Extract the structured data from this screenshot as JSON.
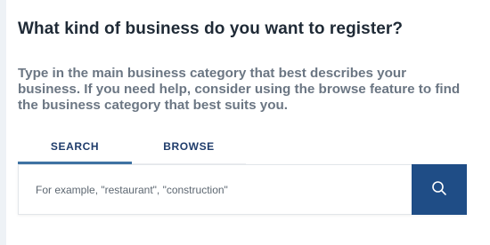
{
  "heading": "What kind of business do you want to register?",
  "description": "Type in the main business category that best describes your business. If you need help, consider using the browse feature to find the business category that best suits you.",
  "tabs": [
    {
      "label": "SEARCH",
      "active": true
    },
    {
      "label": "BROWSE",
      "active": false
    }
  ],
  "search": {
    "placeholder": "For example, \"restaurant\", \"construction\"",
    "value": "",
    "button_icon": "search-icon"
  },
  "colors": {
    "heading": "#1f2a36",
    "description": "#6b7683",
    "tab_text": "#1f3c6b",
    "tab_active_underline": "#3f73a3",
    "search_button": "#1f4d86"
  }
}
